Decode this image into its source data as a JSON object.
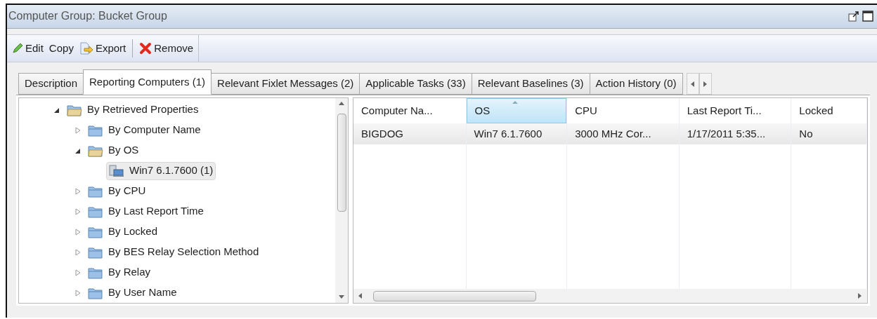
{
  "window": {
    "title": "Computer Group: Bucket Group"
  },
  "toolbar": [
    {
      "kind": "edit",
      "label": "Edit"
    },
    {
      "kind": "plain",
      "label": "Copy"
    },
    {
      "kind": "export",
      "label": "Export"
    },
    {
      "kind": "remove",
      "label": "Remove"
    }
  ],
  "tabs": [
    {
      "label": "Description",
      "selected": false
    },
    {
      "label": "Reporting Computers (1)",
      "selected": true
    },
    {
      "label": "Relevant Fixlet Messages (2)",
      "selected": false
    },
    {
      "label": "Applicable Tasks (33)",
      "selected": false
    },
    {
      "label": "Relevant Baselines (3)",
      "selected": false
    },
    {
      "label": "Action History (0)",
      "selected": false
    }
  ],
  "tree": [
    {
      "label": "By Retrieved Properties",
      "kind": "folder",
      "expanded": true,
      "selected": false,
      "children": [
        {
          "label": "By Computer Name",
          "kind": "folder",
          "expanded": false,
          "selected": false
        },
        {
          "label": "By OS",
          "kind": "folder",
          "expanded": true,
          "selected": false,
          "children": [
            {
              "label": "Win7 6.1.7600 (1)",
              "kind": "computer",
              "selected": true
            }
          ]
        },
        {
          "label": "By CPU",
          "kind": "folder",
          "expanded": false,
          "selected": false
        },
        {
          "label": "By Last Report Time",
          "kind": "folder",
          "expanded": false,
          "selected": false
        },
        {
          "label": "By Locked",
          "kind": "folder",
          "expanded": false,
          "selected": false
        },
        {
          "label": "By BES Relay Selection Method",
          "kind": "folder",
          "expanded": false,
          "selected": false
        },
        {
          "label": "By Relay",
          "kind": "folder",
          "expanded": false,
          "selected": false
        },
        {
          "label": "By User Name",
          "kind": "folder",
          "expanded": false,
          "selected": false
        }
      ]
    }
  ],
  "table": {
    "columns": [
      {
        "label": "Computer Na...",
        "sorted": false
      },
      {
        "label": "OS",
        "sorted": true
      },
      {
        "label": "CPU",
        "sorted": false
      },
      {
        "label": "Last Report Ti...",
        "sorted": false
      },
      {
        "label": "Locked",
        "sorted": false
      }
    ],
    "rows": [
      {
        "cells": [
          "BIGDOG",
          "Win7 6.1.7600",
          "3000 MHz Cor...",
          "1/17/2011 5:35...",
          "No"
        ]
      }
    ]
  }
}
